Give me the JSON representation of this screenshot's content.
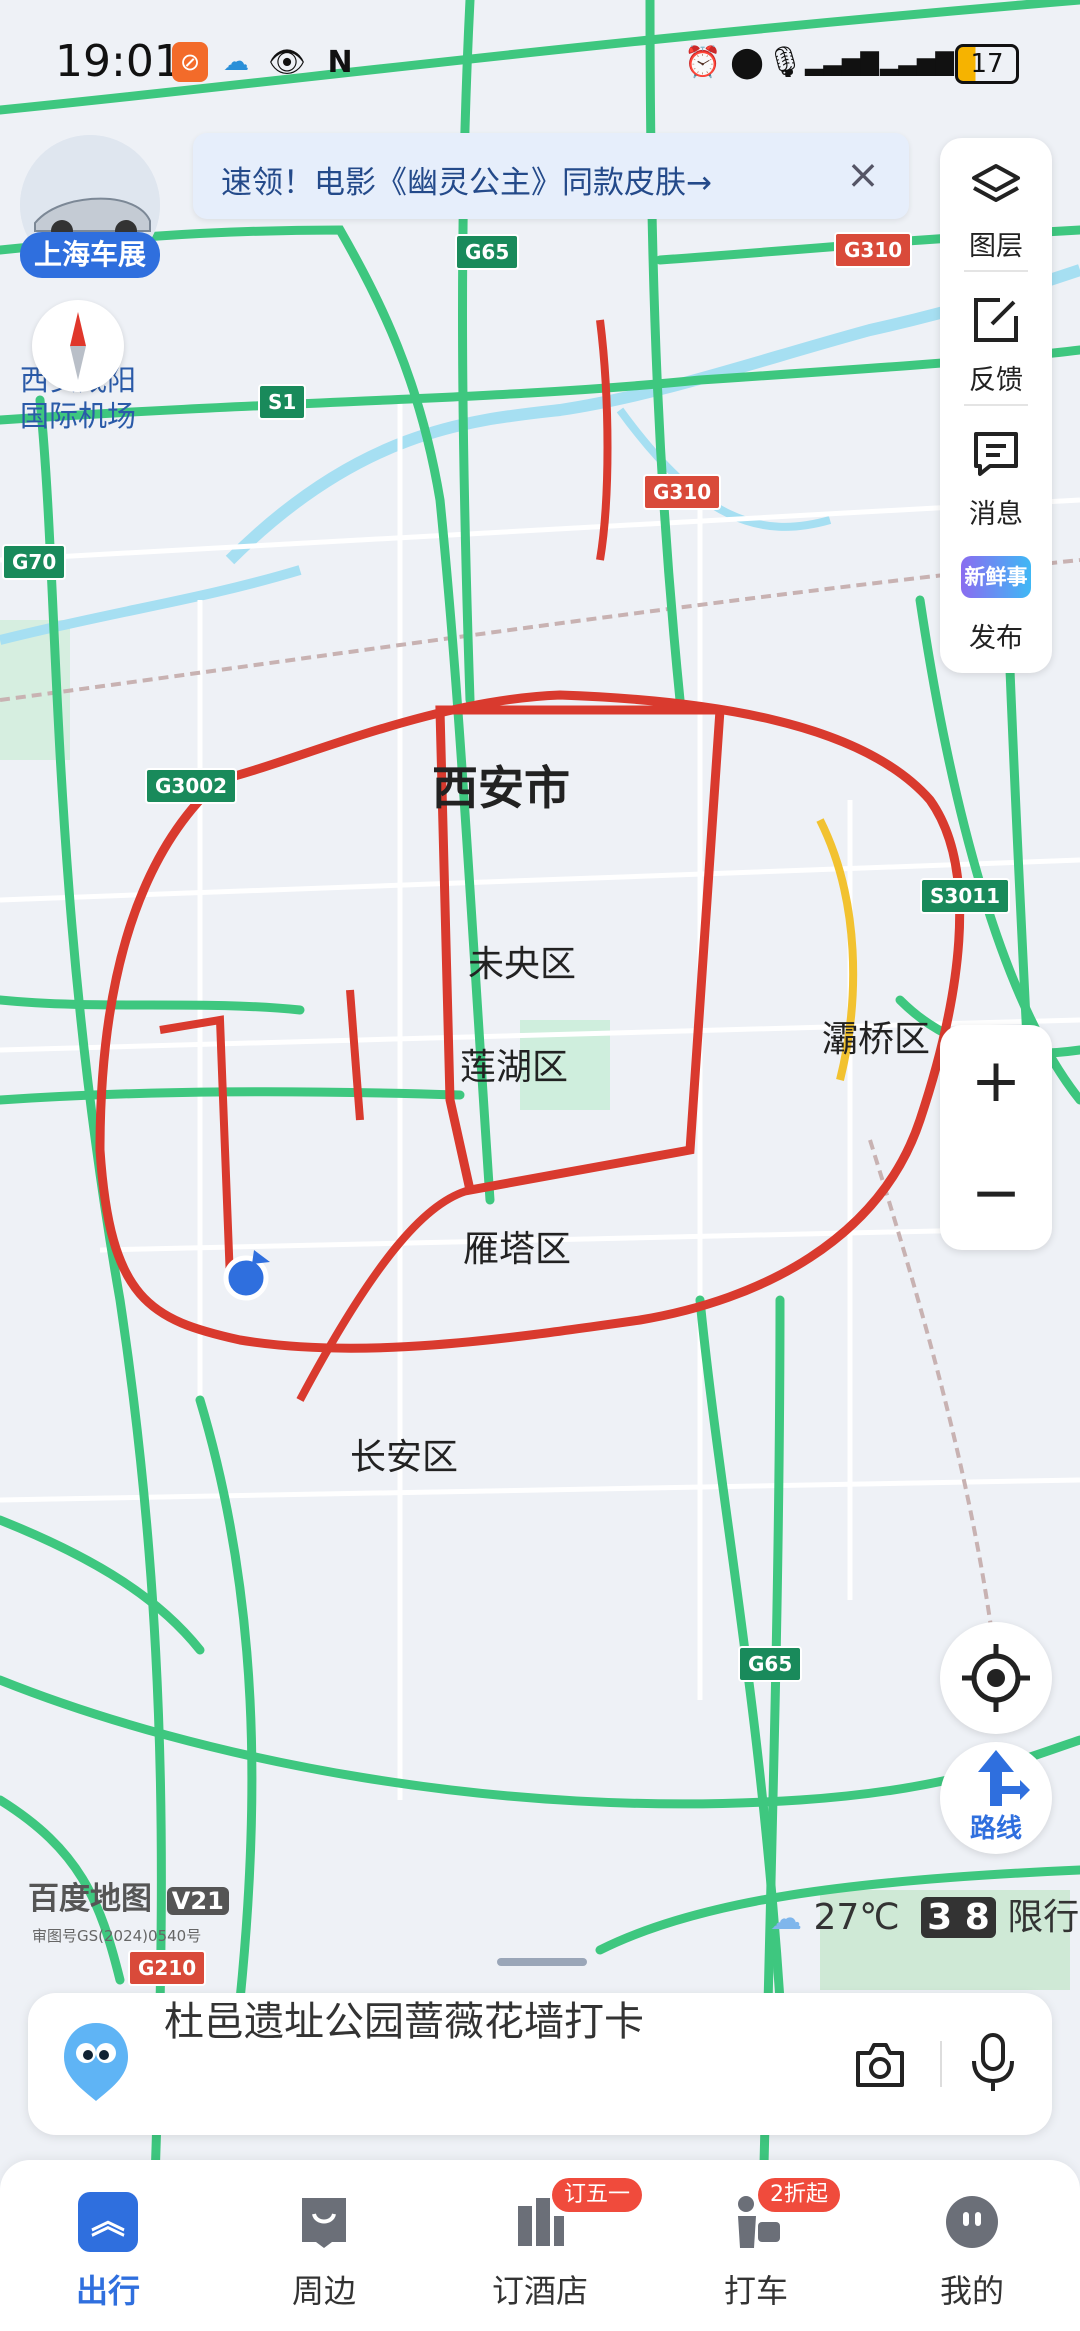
{
  "status_bar": {
    "time": "19:01",
    "battery": "17",
    "icons": [
      "app-notification-icon",
      "cloud-icon",
      "eye-icon",
      "nfc-icon",
      "alarm-icon",
      "location-icon",
      "mic-icon",
      "signal-icon",
      "signal-icon",
      "battery-icon"
    ]
  },
  "banner": {
    "text": "速领！电影《幽灵公主》同款皮肤→"
  },
  "car_show": {
    "label": "上海车展"
  },
  "map": {
    "airport_label": "西安咸阳\n国际机场",
    "city_label": "西安市",
    "districts": [
      "未央区",
      "莲湖区",
      "灞桥区",
      "雁塔区",
      "长安区"
    ],
    "highway_shields": [
      {
        "text": "G65",
        "type": "g"
      },
      {
        "text": "G310",
        "type": "r"
      },
      {
        "text": "S1",
        "type": "g"
      },
      {
        "text": "G310",
        "type": "r"
      },
      {
        "text": "G70",
        "type": "g"
      },
      {
        "text": "G3002",
        "type": "g"
      },
      {
        "text": "S3011",
        "type": "g"
      },
      {
        "text": "G65",
        "type": "g"
      },
      {
        "text": "G210",
        "type": "r"
      }
    ]
  },
  "right_toolbar": {
    "items": [
      {
        "label": "图层",
        "icon": "layers-icon"
      },
      {
        "label": "反馈",
        "icon": "feedback-icon"
      },
      {
        "label": "消息",
        "icon": "message-icon"
      },
      {
        "label": "发布",
        "icon": "publish-icon",
        "icon_text": "新鲜事"
      }
    ]
  },
  "zoom": {
    "in_label": "+",
    "out_label": "−"
  },
  "route_button": {
    "label": "路线"
  },
  "weather": {
    "temp": "27℃",
    "restriction_numbers": "3 8",
    "restriction_label": "限行"
  },
  "map_logo": {
    "text": "百度地图",
    "version": "V21",
    "approval": "审图号GS(2024)0540号"
  },
  "search": {
    "text": "杜邑遗址公园蔷薇花墙打卡"
  },
  "tab_bar": {
    "tabs": [
      {
        "label": "出行",
        "icon": "travel-icon",
        "active": true
      },
      {
        "label": "周边",
        "icon": "nearby-icon"
      },
      {
        "label": "订酒店",
        "icon": "hotel-icon",
        "badge": "订五一"
      },
      {
        "label": "打车",
        "icon": "taxi-icon",
        "badge": "2折起"
      },
      {
        "label": "我的",
        "icon": "profile-icon"
      }
    ]
  },
  "colors": {
    "accent": "#2f6fde",
    "road_green": "#3ec77f",
    "road_red": "#d93a2e",
    "road_yellow": "#f2c230",
    "water": "#a6dff2"
  }
}
